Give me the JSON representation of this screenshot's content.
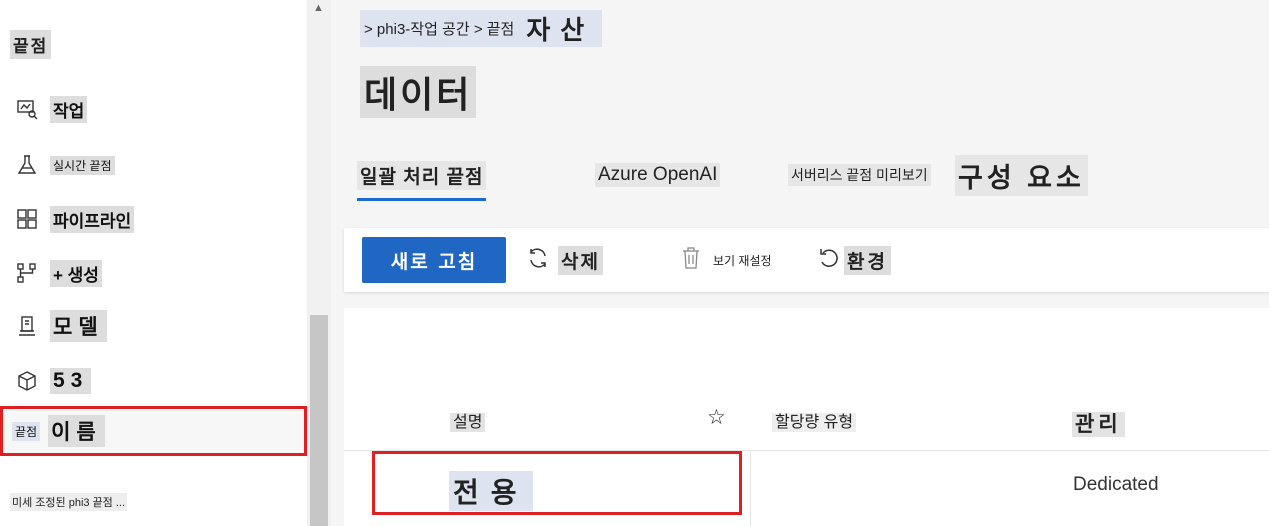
{
  "sidebar": {
    "title": "끝점",
    "items": [
      {
        "label": "작업",
        "icon": "jobs-icon"
      },
      {
        "label": "실시간 끝점",
        "icon": "flask-icon"
      },
      {
        "label": "파이프라인",
        "icon": "pipeline-icon"
      },
      {
        "label": "+ 생성",
        "icon": "branch-icon"
      },
      {
        "label": "모델",
        "icon": "models-icon"
      },
      {
        "label": "53",
        "icon": "cube-icon"
      },
      {
        "label_prefix": "끝점",
        "label": "이름"
      }
    ],
    "footer": "미세 조정된 phi3 끝점 ..."
  },
  "breadcrumb": {
    "path": "> phi3-작업 공간 > 끝점",
    "current": "자산"
  },
  "page": {
    "title": "데이터"
  },
  "tabs": [
    {
      "label": "일괄 처리 끝점",
      "active": true
    },
    {
      "label": "Azure OpenAI"
    },
    {
      "label": "서버리스 끝점 미리보기"
    },
    {
      "label": "구성 요소"
    }
  ],
  "toolbar": {
    "refresh": "새로 고침",
    "delete": "삭제",
    "reset_view": "보기 재설정",
    "environment": "환경"
  },
  "table": {
    "headers": [
      "설명",
      "할당량 유형",
      "관리"
    ],
    "rows": [
      {
        "name": "전용",
        "quota_type": "",
        "managed": "Dedicated"
      }
    ]
  },
  "colors": {
    "accent": "#1f67c3",
    "highlight_border": "#e02020"
  }
}
